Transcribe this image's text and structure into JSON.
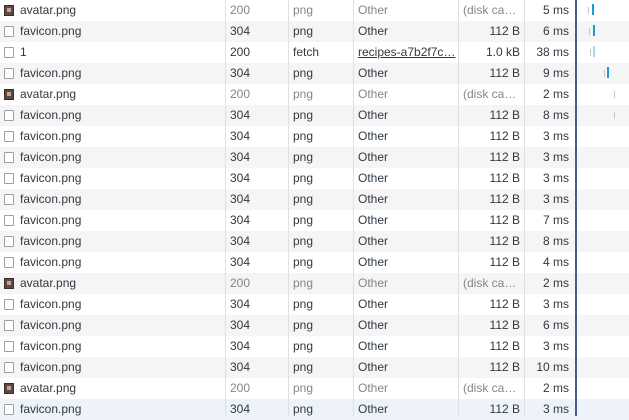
{
  "colors": {
    "waterfall_bar": "#1a9bd7",
    "even_row": "#f5f5f5",
    "selected_row": "#eef3fb"
  },
  "rows": [
    {
      "icon": "avatar-image-icon",
      "name": "avatar.png",
      "status": "200",
      "type": "png",
      "initiator": "Other",
      "size": "(disk ca…",
      "time": "5 ms",
      "cached": true
    },
    {
      "icon": "file-icon",
      "name": "favicon.png",
      "status": "304",
      "type": "png",
      "initiator": "Other",
      "size": "112 B",
      "time": "6 ms",
      "cached": false
    },
    {
      "icon": "file-icon",
      "name": "1",
      "status": "200",
      "type": "fetch",
      "initiator": "recipes-a7b2f7c…",
      "size": "1.0 kB",
      "time": "38 ms",
      "cached": false,
      "initiator_link": true
    },
    {
      "icon": "file-icon",
      "name": "favicon.png",
      "status": "304",
      "type": "png",
      "initiator": "Other",
      "size": "112 B",
      "time": "9 ms",
      "cached": false
    },
    {
      "icon": "avatar-image-icon",
      "name": "avatar.png",
      "status": "200",
      "type": "png",
      "initiator": "Other",
      "size": "(disk ca…",
      "time": "2 ms",
      "cached": true
    },
    {
      "icon": "file-icon",
      "name": "favicon.png",
      "status": "304",
      "type": "png",
      "initiator": "Other",
      "size": "112 B",
      "time": "8 ms",
      "cached": false
    },
    {
      "icon": "file-icon",
      "name": "favicon.png",
      "status": "304",
      "type": "png",
      "initiator": "Other",
      "size": "112 B",
      "time": "3 ms",
      "cached": false
    },
    {
      "icon": "file-icon",
      "name": "favicon.png",
      "status": "304",
      "type": "png",
      "initiator": "Other",
      "size": "112 B",
      "time": "3 ms",
      "cached": false
    },
    {
      "icon": "file-icon",
      "name": "favicon.png",
      "status": "304",
      "type": "png",
      "initiator": "Other",
      "size": "112 B",
      "time": "3 ms",
      "cached": false
    },
    {
      "icon": "file-icon",
      "name": "favicon.png",
      "status": "304",
      "type": "png",
      "initiator": "Other",
      "size": "112 B",
      "time": "3 ms",
      "cached": false
    },
    {
      "icon": "file-icon",
      "name": "favicon.png",
      "status": "304",
      "type": "png",
      "initiator": "Other",
      "size": "112 B",
      "time": "7 ms",
      "cached": false
    },
    {
      "icon": "file-icon",
      "name": "favicon.png",
      "status": "304",
      "type": "png",
      "initiator": "Other",
      "size": "112 B",
      "time": "8 ms",
      "cached": false
    },
    {
      "icon": "file-icon",
      "name": "favicon.png",
      "status": "304",
      "type": "png",
      "initiator": "Other",
      "size": "112 B",
      "time": "4 ms",
      "cached": false
    },
    {
      "icon": "avatar-image-icon",
      "name": "avatar.png",
      "status": "200",
      "type": "png",
      "initiator": "Other",
      "size": "(disk ca…",
      "time": "2 ms",
      "cached": true
    },
    {
      "icon": "file-icon",
      "name": "favicon.png",
      "status": "304",
      "type": "png",
      "initiator": "Other",
      "size": "112 B",
      "time": "3 ms",
      "cached": false
    },
    {
      "icon": "file-icon",
      "name": "favicon.png",
      "status": "304",
      "type": "png",
      "initiator": "Other",
      "size": "112 B",
      "time": "6 ms",
      "cached": false
    },
    {
      "icon": "file-icon",
      "name": "favicon.png",
      "status": "304",
      "type": "png",
      "initiator": "Other",
      "size": "112 B",
      "time": "3 ms",
      "cached": false
    },
    {
      "icon": "file-icon",
      "name": "favicon.png",
      "status": "304",
      "type": "png",
      "initiator": "Other",
      "size": "112 B",
      "time": "10 ms",
      "cached": false
    },
    {
      "icon": "avatar-image-icon",
      "name": "avatar.png",
      "status": "200",
      "type": "png",
      "initiator": "Other",
      "size": "(disk ca…",
      "time": "2 ms",
      "cached": true
    },
    {
      "icon": "file-icon",
      "name": "favicon.png",
      "status": "304",
      "type": "png",
      "initiator": "Other",
      "size": "112 B",
      "time": "3 ms",
      "cached": false
    }
  ]
}
